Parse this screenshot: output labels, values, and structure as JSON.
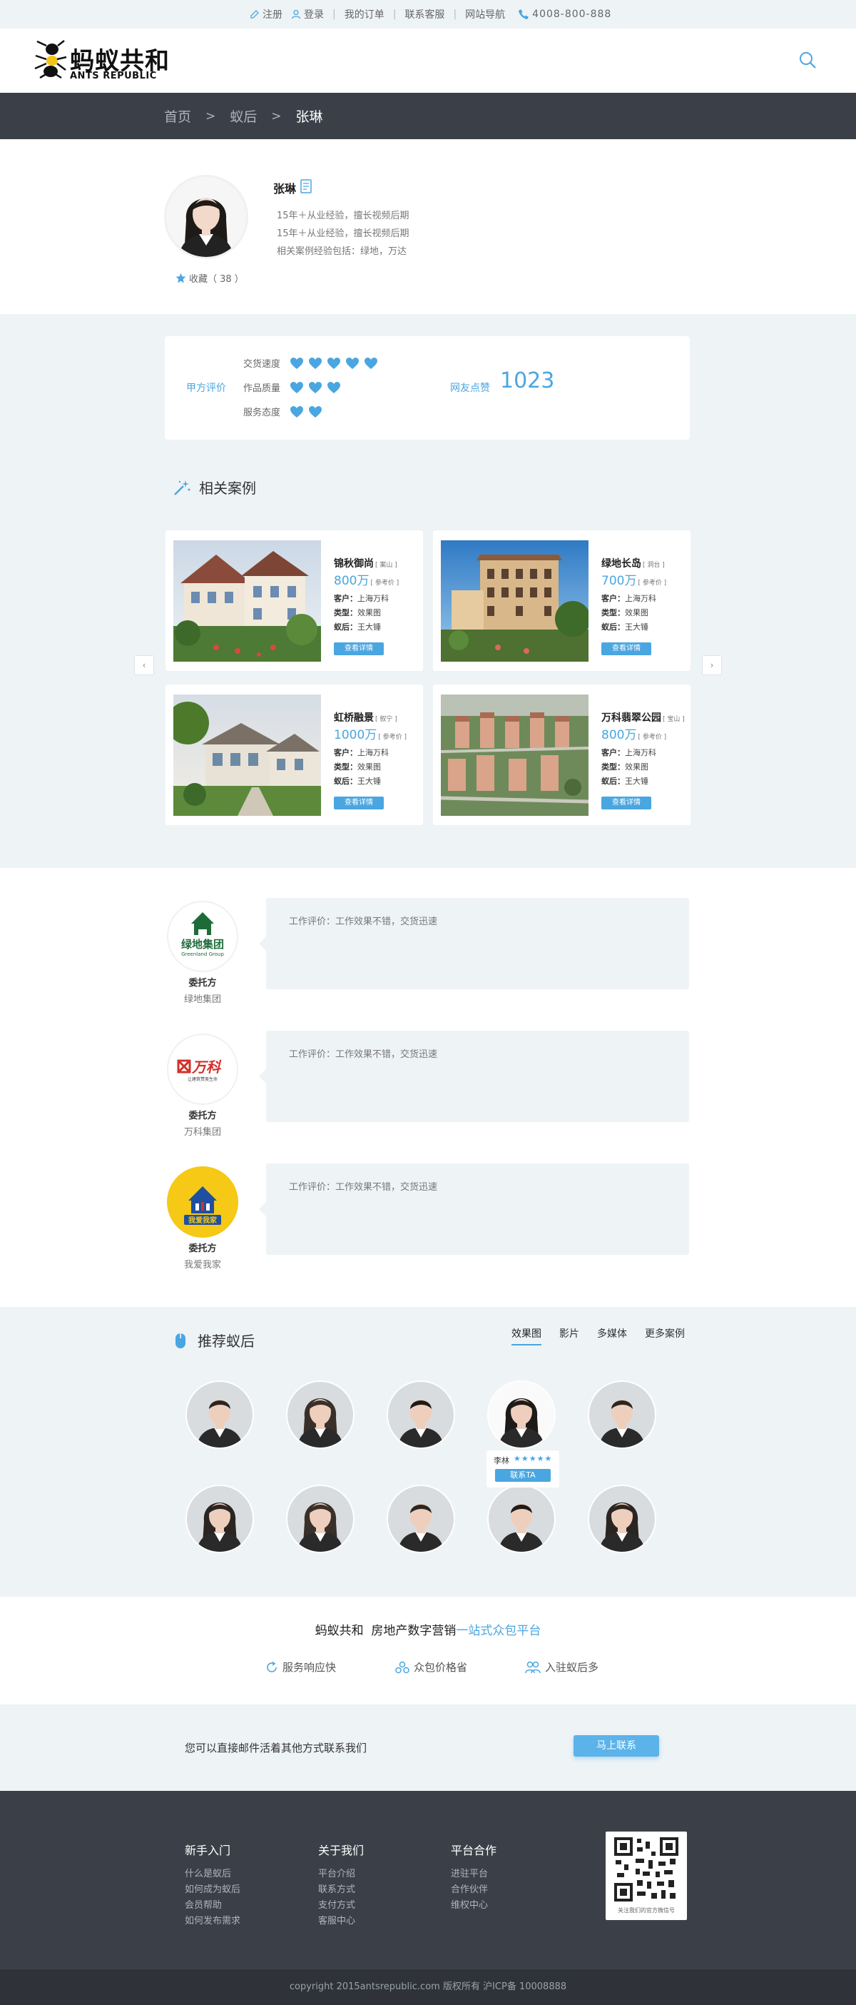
{
  "topbar": {
    "register": "注册",
    "login": "登录",
    "orders": "我的订单",
    "service": "联系客服",
    "sitenav": "网站导航",
    "phone": "4008-800-888"
  },
  "brand": {
    "cn": "蚂蚁共和",
    "en": "ANTS REPUBLIC"
  },
  "breadcrumb": {
    "home": "首页",
    "sep": ">",
    "level2": "蚁后",
    "current": "张琳"
  },
  "profile": {
    "name": "张琳",
    "lines": [
      "15年＋从业经验，擅长视频后期",
      "15年＋从业经验，擅长视频后期",
      "相关案例经验包括：绿地，万达"
    ],
    "fav_label": "收藏（ 38 ）"
  },
  "rating": {
    "title": "甲方评价",
    "items": [
      {
        "label": "交货速度",
        "hearts": 5
      },
      {
        "label": "作品质量",
        "hearts": 3
      },
      {
        "label": "服务态度",
        "hearts": 2
      }
    ],
    "likes_label": "网友点赞",
    "likes_value": "1023"
  },
  "cases": {
    "title": "相关案例",
    "prev": "‹",
    "next": "›",
    "items": [
      {
        "name": "锦秋御尚",
        "tag": "[ 案山 ]",
        "price": "800万",
        "price_note": "[ 参考价 ]",
        "client_label": "客户：",
        "client": "上海万科",
        "type_label": "类型：",
        "type": "效果图",
        "queen_label": "蚁后：",
        "queen": "王大锤",
        "btn": "查看详情"
      },
      {
        "name": "绿地长岛",
        "tag": "[ 洞台 ]",
        "price": "700万",
        "price_note": "[ 参考价 ]",
        "client_label": "客户：",
        "client": "上海万科",
        "type_label": "类型：",
        "type": "效果图",
        "queen_label": "蚁后：",
        "queen": "王大锤",
        "btn": "查看详情"
      },
      {
        "name": "虹桥融景",
        "tag": "[ 叙宁 ]",
        "price": "1000万",
        "price_note": "[ 参考价 ]",
        "client_label": "客户：",
        "client": "上海万科",
        "type_label": "类型：",
        "type": "效果图",
        "queen_label": "蚁后：",
        "queen": "王大锤",
        "btn": "查看详情"
      },
      {
        "name": "万科翡翠公园",
        "tag": "[ 宝山 ]",
        "price": "800万",
        "price_note": "[ 参考价 ]",
        "client_label": "客户：",
        "client": "上海万科",
        "type_label": "类型：",
        "type": "效果图",
        "queen_label": "蚁后：",
        "queen": "王大锤",
        "btn": "查看详情"
      }
    ]
  },
  "reviews": [
    {
      "role": "委托方",
      "company": "绿地集团",
      "logo_cn": "绿地集团",
      "logo_en": "Greenland Group",
      "text": "工作评价：工作效果不错，交货迅速"
    },
    {
      "role": "委托方",
      "company": "万科集团",
      "logo_cn": "万科",
      "logo_en": "让建筑赞美生命",
      "text": "工作评价：工作效果不错，交货迅速"
    },
    {
      "role": "委托方",
      "company": "我爱我家",
      "logo_cn": "我爱我家",
      "logo_en": "",
      "text": "工作评价：工作效果不错，交货迅速"
    }
  ],
  "recommend": {
    "title": "推荐蚁后",
    "tabs": [
      "效果图",
      "影片",
      "多媒体",
      "更多案例"
    ],
    "tip": {
      "name": "李林",
      "stars": "★★★★★",
      "btn": "联系TA"
    }
  },
  "slogan": {
    "brand": "蚂蚁共和",
    "mid": "房地产数字营销",
    "hl": "一站式众包平台"
  },
  "features": [
    "服务响应快",
    "众包价格省",
    "入驻蚁后多"
  ],
  "contact": {
    "text": "您可以直接邮件活着其他方式联系我们",
    "btn": "马上联系"
  },
  "footer": {
    "cols": [
      {
        "title": "新手入门",
        "links": [
          "什么是蚁后",
          "如何成为蚁后",
          "会员帮助",
          "如何发布需求"
        ]
      },
      {
        "title": "关于我们",
        "links": [
          "平台介绍",
          "联系方式",
          "支付方式",
          "客服中心"
        ]
      },
      {
        "title": "平台合作",
        "links": [
          "进驻平台",
          "合作伙伴",
          "维权中心"
        ]
      }
    ],
    "qr_caption": "关注我们的官方微信号"
  },
  "copyright": "copyright 2015antsrepublic.com 版权所有 沪ICP备 10008888",
  "colors": {
    "accent": "#4aa6e0",
    "dark": "#3b4048",
    "light_bg": "#eef3f6"
  }
}
